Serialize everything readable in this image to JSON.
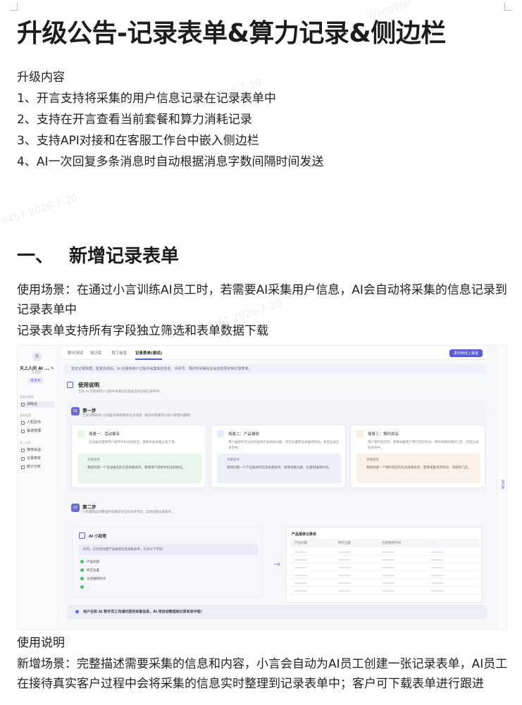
{
  "title": "升级公告-记录表单&算力记录&侧边栏",
  "upgrade": {
    "heading": "升级内容",
    "items": [
      "1、开言支持将采集的用户信息记录在记录表单中",
      "2、支持在开言查看当前套餐和算力消耗记录",
      "3、支持API对接和在客服工作台中嵌入侧边栏",
      "4、AI一次回复多条消息时自动根据消息字数间隔时间发送"
    ]
  },
  "section1": {
    "number": "一、",
    "title": "新增记录表单",
    "scene_lines": [
      "使用场景：在通过小言训练AI员工时，若需要AI采集用户信息，AI会自动将采集的信息记录到",
      "记录表单中"
    ],
    "filter_line": "记录表单支持所有字段独立筛选和表单数据下载"
  },
  "screenshot": {
    "sidebar": {
      "avatar": "天",
      "name": "天上人间 AI ... ✎",
      "sub": "工作台",
      "tag": "待发布",
      "groups": [
        "智能体管理",
        "基础配置",
        "线上运营"
      ],
      "items": [
        "训练台",
        "人机协作",
        "渠道管理",
        "接待会话",
        "记录表单",
        "统计分析"
      ]
    },
    "tabs": [
      "聊天测试",
      "知识库",
      "员工信息",
      "记录表单(测试)"
    ],
    "publish_button": "发布到线上渠道",
    "rail_label": "知识库",
    "notice": "暂无记录数据，配置完成后，AI 在接待用户过程中采集到的姓名、手机号、预约时间等信息会自动同步到记录表单。",
    "intro": {
      "title": "使用说明",
      "sub": "告诉 AI 在接待用户过程中采集的信息会自动记录在表单中。"
    },
    "step1": {
      "badge": "01",
      "title": "第一步",
      "sub": "告诉训练助手(小助理)你要收集的信息场景（更多场景都可以找小助理沟通哦）",
      "cards": [
        {
          "title": "场景一：活动报名",
          "desc": "活动报名需要用户提供手机号和姓名，需要系统采集记录下来。",
          "ex_label": "示例话术",
          "ex_text": "我想创建一个活动报名的信息采集表单，需要用户提供手机号和姓名。"
        },
        {
          "title": "场景二：产品报修",
          "desc": "用户报修时无法及时提供产品相关问题、所在位置和合适维修时间，希望记录在表单中。",
          "ex_label": "示例话术",
          "ex_text": "我想创建一个产品报修的信息采集表单，需要采集问题、位置和维修时间。"
        },
        {
          "title": "场景三：预约到店",
          "desc": "用户预约到店时，需要采集用户预计到店时间、预约项目和预约门店，然后记录在表单中。",
          "ex_label": "示例话术",
          "ex_text": "我想创建一个预约到店的信息采集表单，需要采集到店时间、项目和门店。"
        }
      ]
    },
    "step2": {
      "badge": "02",
      "title": "第二步",
      "sub": "小助理会自动整理并创建好对应的表单字段，自动创建记录表单。",
      "chat_title": "AI 小助理",
      "chat_bubble": "好的，已为您创建产品报修信息采集表单，包含以下字段：",
      "fields": [
        "产品问题",
        "所在位置",
        "合适维修时间",
        "..."
      ],
      "table_title": "产品报修记录表",
      "table_headers": [
        "产品问题",
        "所在位置",
        "合适维修时间",
        "..."
      ]
    },
    "hint": "用户在和 AI 数字员工沟通时提供采集信息，AI 将自动整理到记录表单中啦！"
  },
  "usage": {
    "heading": "使用说明",
    "lines": [
      "新增场景：完整描述需要采集的信息和内容，小言会自动为AI员工创建一张记录表单，AI员工",
      "在接待真实客户过程中会将采集的信息实时整理到记录表单中；客户可下载表单进行跟进"
    ]
  },
  "colors": {
    "accent": "#5b5bd6",
    "text": "#222222"
  }
}
